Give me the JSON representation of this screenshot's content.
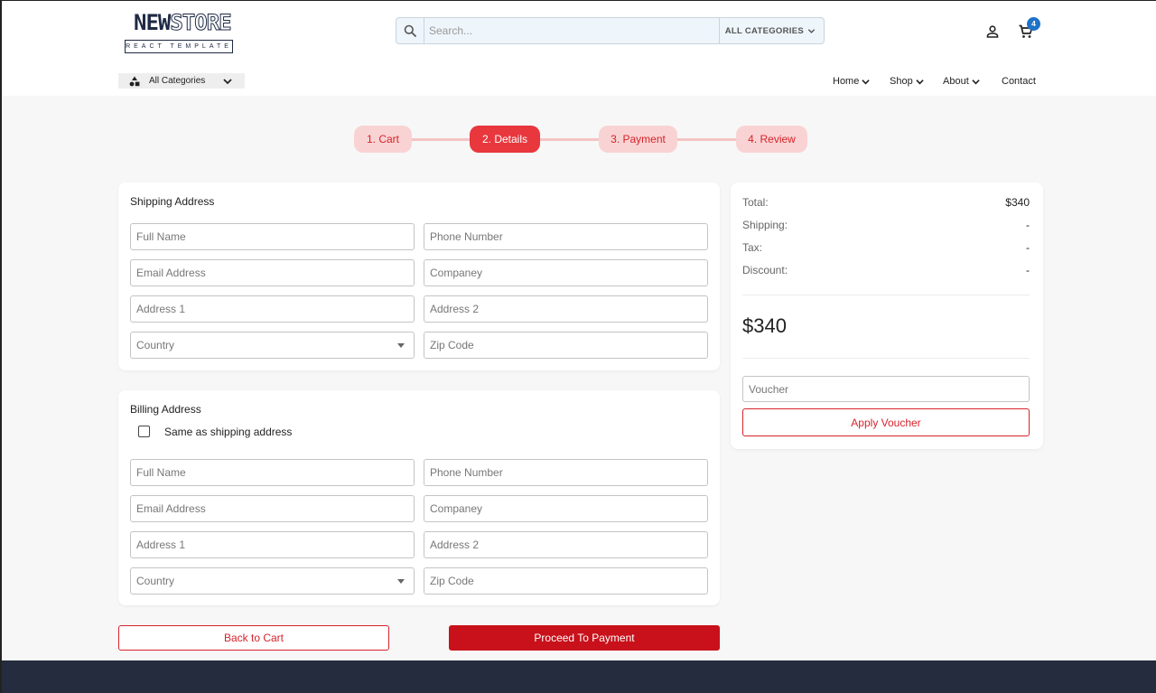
{
  "header": {
    "logo_main": "NEW",
    "logo_accent": "STORE",
    "logo_sub": "REACT TEMPLATE",
    "search_placeholder": "Search...",
    "search_category": "ALL CATEGORIES",
    "cart_count": "4",
    "icons": {
      "search": "search-icon",
      "user": "user-icon",
      "cart": "cart-icon"
    }
  },
  "subnav": {
    "all_categories": "All Categories",
    "menu": [
      {
        "label": "Home",
        "dropdown": true
      },
      {
        "label": "Shop",
        "dropdown": true
      },
      {
        "label": "About",
        "dropdown": true
      },
      {
        "label": "Contact",
        "dropdown": false
      }
    ]
  },
  "steps": [
    {
      "label": "1. Cart",
      "active": false
    },
    {
      "label": "2. Details",
      "active": true
    },
    {
      "label": "3. Payment",
      "active": false
    },
    {
      "label": "4. Review",
      "active": false
    }
  ],
  "shipping": {
    "title": "Shipping Address",
    "full_name": "Full Name",
    "phone": "Phone Number",
    "email": "Email Address",
    "company": "Companey",
    "address1": "Address 1",
    "address2": "Address 2",
    "country": "Country",
    "zip": "Zip Code"
  },
  "billing": {
    "title": "Billing Address",
    "same_as_shipping": "Same as shipping address",
    "same_checked": false,
    "full_name": "Full Name",
    "phone": "Phone Number",
    "email": "Email Address",
    "company": "Companey",
    "address1": "Address 1",
    "address2": "Address 2",
    "country": "Country",
    "zip": "Zip Code"
  },
  "summary": {
    "total_label": "Total:",
    "total_value": "$340",
    "shipping_label": "Shipping:",
    "shipping_value": "-",
    "tax_label": "Tax:",
    "tax_value": "-",
    "discount_label": "Discount:",
    "discount_value": "-",
    "grand_total": "$340",
    "voucher_placeholder": "Voucher",
    "apply_voucher": "Apply Voucher"
  },
  "actions": {
    "back": "Back to Cart",
    "proceed": "Proceed To Payment"
  },
  "colors": {
    "accent": "#e8373d",
    "accent_dark": "#c8111b",
    "step_inactive_bg": "#f9d3d3",
    "badge": "#1e73c8",
    "footer": "#252c3d"
  }
}
